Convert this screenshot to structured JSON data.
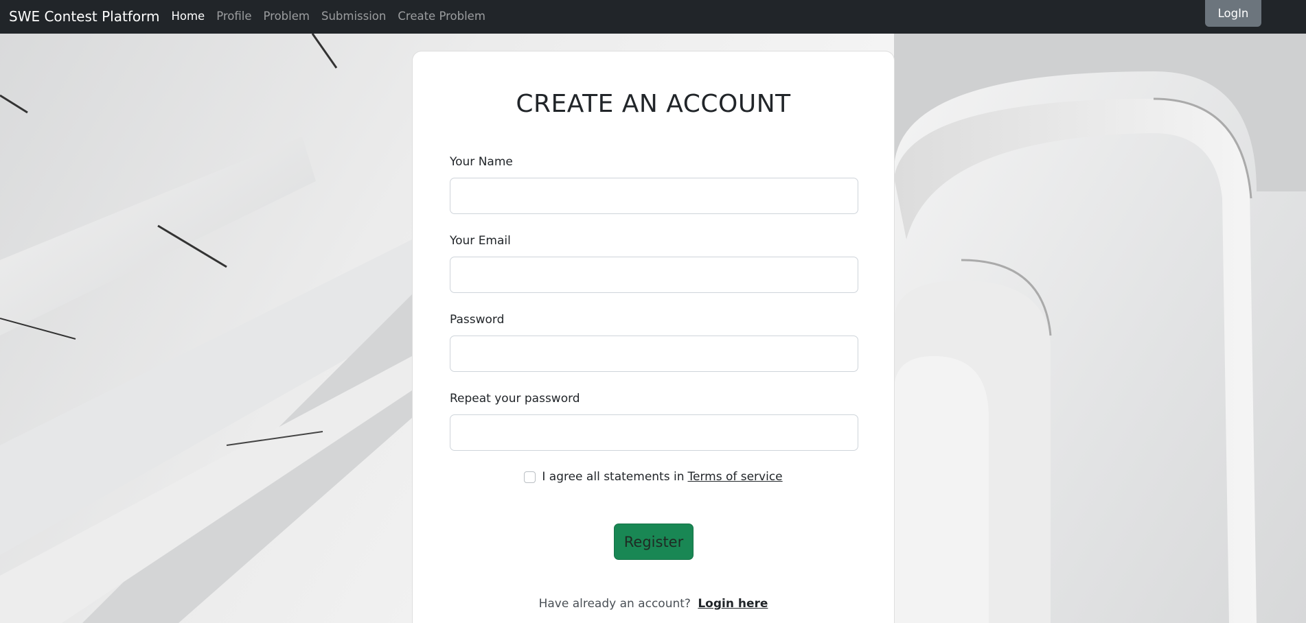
{
  "navbar": {
    "brand": "SWE Contest Platform",
    "links": [
      {
        "label": "Home",
        "active": true
      },
      {
        "label": "Profile",
        "active": false
      },
      {
        "label": "Problem",
        "active": false
      },
      {
        "label": "Submission",
        "active": false
      },
      {
        "label": "Create Problem",
        "active": false
      }
    ],
    "login_label": "LogIn"
  },
  "form": {
    "title": "CREATE AN ACCOUNT",
    "fields": [
      {
        "label": "Your Name",
        "value": "",
        "placeholder": ""
      },
      {
        "label": "Your Email",
        "value": "",
        "placeholder": ""
      },
      {
        "label": "Password",
        "value": "",
        "placeholder": ""
      },
      {
        "label": "Repeat your password",
        "value": "",
        "placeholder": ""
      }
    ],
    "agree_text": "I agree all statements in",
    "terms_link": "Terms of service",
    "agree_checked": false,
    "register_label": "Register",
    "login_prompt": "Have already an account?",
    "login_link": "Login here"
  },
  "colors": {
    "navbar_bg": "#212529",
    "primary_success": "#198754",
    "secondary": "#6c757d"
  }
}
